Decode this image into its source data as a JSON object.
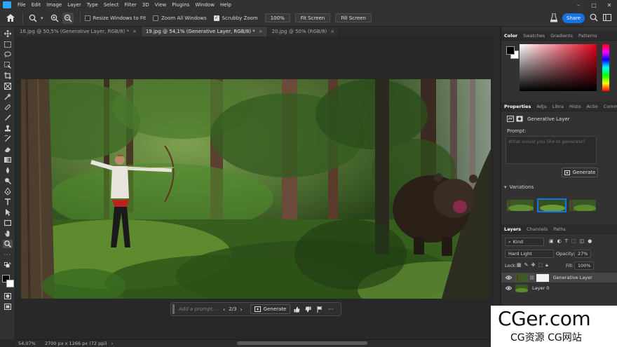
{
  "menu": [
    "File",
    "Edit",
    "Image",
    "Layer",
    "Type",
    "Select",
    "Filter",
    "3D",
    "View",
    "Plugins",
    "Window",
    "Help"
  ],
  "options": {
    "resize_windows": "Resize Windows to Fit",
    "zoom_all": "Zoom All Windows",
    "scrubby": "Scrubby Zoom",
    "zoom_value": "100%",
    "fit_screen": "Fit Screen",
    "fill_screen": "Fill Screen",
    "share": "Share"
  },
  "tabs": [
    {
      "label": "16.jpg @ 50,5% (Generative Layer, RGB/8) *"
    },
    {
      "label": "19.jpg @ 54,1% (Generative Layer, RGB/8) *"
    },
    {
      "label": "20.jpg @ 50% (RGB/8)"
    }
  ],
  "contextual": {
    "prompt_placeholder": "Add a prompt...",
    "counter": "2/3",
    "generate": "Generate"
  },
  "status": {
    "zoom": "54,07%",
    "doc": "2700 px x 1266 px (72 ppi)"
  },
  "color_panel": {
    "tabs": [
      "Color",
      "Swatches",
      "Gradients",
      "Patterns"
    ]
  },
  "properties_panel": {
    "tabs": [
      "Properties",
      "Adju",
      "Libra",
      "Histo",
      "Actio",
      "Comm"
    ],
    "layer_type": "Generative Layer",
    "prompt_label": "Prompt:",
    "prompt_placeholder": "What would you like to generate?",
    "generate": "Generate",
    "variations_label": "Variations"
  },
  "layers_panel": {
    "tabs": [
      "Layers",
      "Channels",
      "Paths"
    ],
    "filter": "Kind",
    "blend_mode": "Hard Light",
    "opacity_label": "Opacity:",
    "opacity": "27%",
    "lock_label": "Lock:",
    "fill_label": "Fill:",
    "fill": "100%",
    "layers": [
      {
        "name": "Generative Layer"
      },
      {
        "name": "Layer 0"
      }
    ]
  },
  "watermark": {
    "main": "CGer.com",
    "sub": "CG资源 CG网站"
  }
}
